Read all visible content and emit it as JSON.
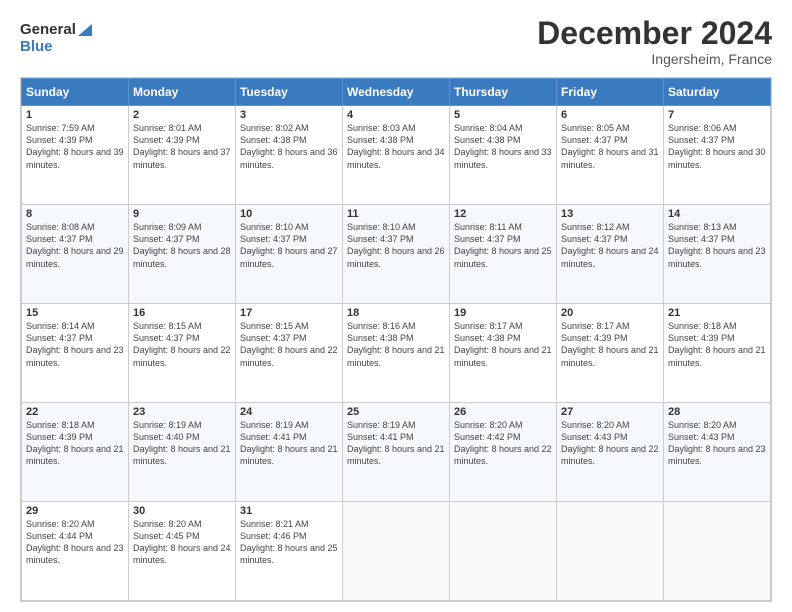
{
  "logo": {
    "text_general": "General",
    "text_blue": "Blue"
  },
  "header": {
    "title": "December 2024",
    "subtitle": "Ingersheim, France"
  },
  "calendar": {
    "days_of_week": [
      "Sunday",
      "Monday",
      "Tuesday",
      "Wednesday",
      "Thursday",
      "Friday",
      "Saturday"
    ],
    "weeks": [
      [
        null,
        {
          "day": "2",
          "sunrise": "Sunrise: 8:01 AM",
          "sunset": "Sunset: 4:39 PM",
          "daylight": "Daylight: 8 hours and 37 minutes."
        },
        {
          "day": "3",
          "sunrise": "Sunrise: 8:02 AM",
          "sunset": "Sunset: 4:38 PM",
          "daylight": "Daylight: 8 hours and 36 minutes."
        },
        {
          "day": "4",
          "sunrise": "Sunrise: 8:03 AM",
          "sunset": "Sunset: 4:38 PM",
          "daylight": "Daylight: 8 hours and 34 minutes."
        },
        {
          "day": "5",
          "sunrise": "Sunrise: 8:04 AM",
          "sunset": "Sunset: 4:38 PM",
          "daylight": "Daylight: 8 hours and 33 minutes."
        },
        {
          "day": "6",
          "sunrise": "Sunrise: 8:05 AM",
          "sunset": "Sunset: 4:37 PM",
          "daylight": "Daylight: 8 hours and 31 minutes."
        },
        {
          "day": "7",
          "sunrise": "Sunrise: 8:06 AM",
          "sunset": "Sunset: 4:37 PM",
          "daylight": "Daylight: 8 hours and 30 minutes."
        }
      ],
      [
        {
          "day": "1",
          "sunrise": "Sunrise: 7:59 AM",
          "sunset": "Sunset: 4:39 PM",
          "daylight": "Daylight: 8 hours and 39 minutes."
        },
        {
          "day": "9",
          "sunrise": "Sunrise: 8:09 AM",
          "sunset": "Sunset: 4:37 PM",
          "daylight": "Daylight: 8 hours and 28 minutes."
        },
        {
          "day": "10",
          "sunrise": "Sunrise: 8:10 AM",
          "sunset": "Sunset: 4:37 PM",
          "daylight": "Daylight: 8 hours and 27 minutes."
        },
        {
          "day": "11",
          "sunrise": "Sunrise: 8:10 AM",
          "sunset": "Sunset: 4:37 PM",
          "daylight": "Daylight: 8 hours and 26 minutes."
        },
        {
          "day": "12",
          "sunrise": "Sunrise: 8:11 AM",
          "sunset": "Sunset: 4:37 PM",
          "daylight": "Daylight: 8 hours and 25 minutes."
        },
        {
          "day": "13",
          "sunrise": "Sunrise: 8:12 AM",
          "sunset": "Sunset: 4:37 PM",
          "daylight": "Daylight: 8 hours and 24 minutes."
        },
        {
          "day": "14",
          "sunrise": "Sunrise: 8:13 AM",
          "sunset": "Sunset: 4:37 PM",
          "daylight": "Daylight: 8 hours and 23 minutes."
        }
      ],
      [
        {
          "day": "8",
          "sunrise": "Sunrise: 8:08 AM",
          "sunset": "Sunset: 4:37 PM",
          "daylight": "Daylight: 8 hours and 29 minutes."
        },
        {
          "day": "16",
          "sunrise": "Sunrise: 8:15 AM",
          "sunset": "Sunset: 4:37 PM",
          "daylight": "Daylight: 8 hours and 22 minutes."
        },
        {
          "day": "17",
          "sunrise": "Sunrise: 8:15 AM",
          "sunset": "Sunset: 4:37 PM",
          "daylight": "Daylight: 8 hours and 22 minutes."
        },
        {
          "day": "18",
          "sunrise": "Sunrise: 8:16 AM",
          "sunset": "Sunset: 4:38 PM",
          "daylight": "Daylight: 8 hours and 21 minutes."
        },
        {
          "day": "19",
          "sunrise": "Sunrise: 8:17 AM",
          "sunset": "Sunset: 4:38 PM",
          "daylight": "Daylight: 8 hours and 21 minutes."
        },
        {
          "day": "20",
          "sunrise": "Sunrise: 8:17 AM",
          "sunset": "Sunset: 4:39 PM",
          "daylight": "Daylight: 8 hours and 21 minutes."
        },
        {
          "day": "21",
          "sunrise": "Sunrise: 8:18 AM",
          "sunset": "Sunset: 4:39 PM",
          "daylight": "Daylight: 8 hours and 21 minutes."
        }
      ],
      [
        {
          "day": "15",
          "sunrise": "Sunrise: 8:14 AM",
          "sunset": "Sunset: 4:37 PM",
          "daylight": "Daylight: 8 hours and 23 minutes."
        },
        {
          "day": "23",
          "sunrise": "Sunrise: 8:19 AM",
          "sunset": "Sunset: 4:40 PM",
          "daylight": "Daylight: 8 hours and 21 minutes."
        },
        {
          "day": "24",
          "sunrise": "Sunrise: 8:19 AM",
          "sunset": "Sunset: 4:41 PM",
          "daylight": "Daylight: 8 hours and 21 minutes."
        },
        {
          "day": "25",
          "sunrise": "Sunrise: 8:19 AM",
          "sunset": "Sunset: 4:41 PM",
          "daylight": "Daylight: 8 hours and 21 minutes."
        },
        {
          "day": "26",
          "sunrise": "Sunrise: 8:20 AM",
          "sunset": "Sunset: 4:42 PM",
          "daylight": "Daylight: 8 hours and 22 minutes."
        },
        {
          "day": "27",
          "sunrise": "Sunrise: 8:20 AM",
          "sunset": "Sunset: 4:43 PM",
          "daylight": "Daylight: 8 hours and 22 minutes."
        },
        {
          "day": "28",
          "sunrise": "Sunrise: 8:20 AM",
          "sunset": "Sunset: 4:43 PM",
          "daylight": "Daylight: 8 hours and 23 minutes."
        }
      ],
      [
        {
          "day": "22",
          "sunrise": "Sunrise: 8:18 AM",
          "sunset": "Sunset: 4:39 PM",
          "daylight": "Daylight: 8 hours and 21 minutes."
        },
        {
          "day": "30",
          "sunrise": "Sunrise: 8:20 AM",
          "sunset": "Sunset: 4:45 PM",
          "daylight": "Daylight: 8 hours and 24 minutes."
        },
        {
          "day": "31",
          "sunrise": "Sunrise: 8:21 AM",
          "sunset": "Sunset: 4:46 PM",
          "daylight": "Daylight: 8 hours and 25 minutes."
        },
        null,
        null,
        null,
        null
      ],
      [
        {
          "day": "29",
          "sunrise": "Sunrise: 8:20 AM",
          "sunset": "Sunset: 4:44 PM",
          "daylight": "Daylight: 8 hours and 23 minutes."
        },
        null,
        null,
        null,
        null,
        null,
        null
      ]
    ]
  }
}
